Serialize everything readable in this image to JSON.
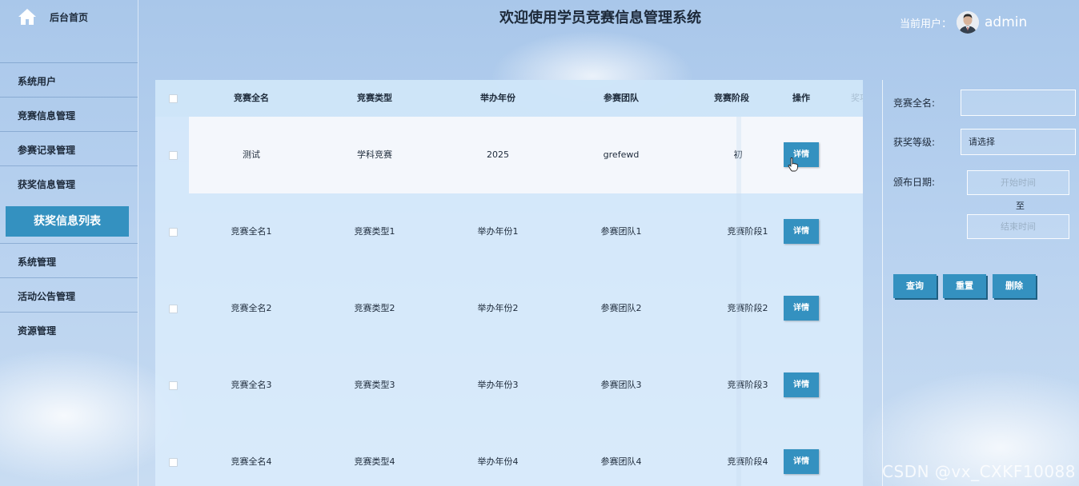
{
  "sidebar": {
    "home_label": "后台首页",
    "items": [
      "系统用户",
      "竞赛信息管理",
      "参赛记录管理",
      "获奖信息管理"
    ],
    "active_sub": "获奖信息列表",
    "items_after": [
      "系统管理",
      "活动公告管理",
      "资源管理"
    ]
  },
  "header": {
    "title": "欢迎使用学员竞赛信息管理系统",
    "user_label": "当前用户：",
    "user_name": "admin"
  },
  "table": {
    "columns": [
      "竞赛全名",
      "竞赛类型",
      "举办年份",
      "参赛团队",
      "竞赛阶段",
      "操作",
      "奖项"
    ],
    "action_label": "详情",
    "rows": [
      {
        "name": "测试",
        "type": "学科竞赛",
        "year": "2025",
        "team": "grefewd",
        "stage": "初",
        "highlight": true
      },
      {
        "name": "竞赛全名1",
        "type": "竞赛类型1",
        "year": "举办年份1",
        "team": "参赛团队1",
        "stage": "竞赛阶段1"
      },
      {
        "name": "竞赛全名2",
        "type": "竞赛类型2",
        "year": "举办年份2",
        "team": "参赛团队2",
        "stage": "竞赛阶段2"
      },
      {
        "name": "竞赛全名3",
        "type": "竞赛类型3",
        "year": "举办年份3",
        "team": "参赛团队3",
        "stage": "竞赛阶段3"
      },
      {
        "name": "竞赛全名4",
        "type": "竞赛类型4",
        "year": "举办年份4",
        "team": "参赛团队4",
        "stage": "竞赛阶段4"
      }
    ]
  },
  "filter": {
    "name_label": "竞赛全名:",
    "name_value": "",
    "level_label": "获奖等级:",
    "level_value": "请选择",
    "date_label": "颁布日期:",
    "start_placeholder": "开始时间",
    "to_label": "至",
    "end_placeholder": "结束时间",
    "buttons": {
      "search": "查询",
      "reset": "重置",
      "delete": "删除"
    }
  },
  "watermark": "CSDN @vx_CXKF10088",
  "colors": {
    "accent": "#3491c0",
    "text": "#1d2a3a"
  }
}
